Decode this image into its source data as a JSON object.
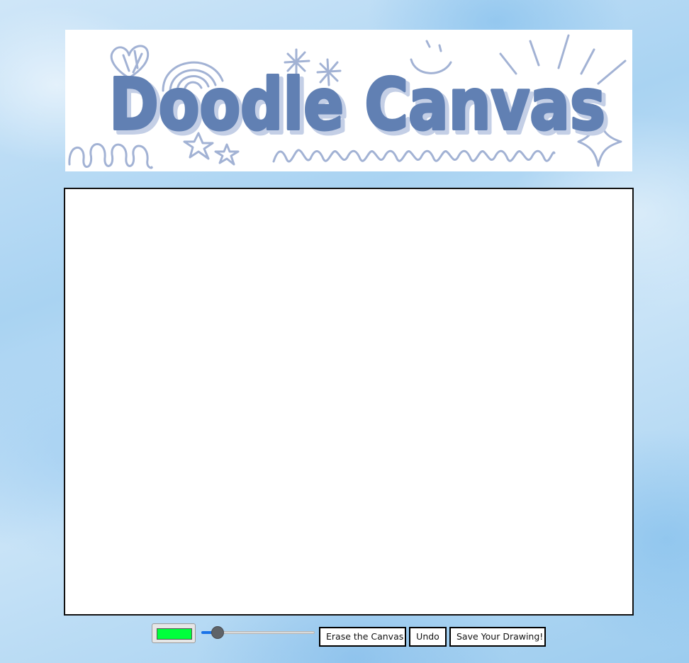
{
  "header": {
    "title": "Doodle Canvas",
    "title_color": "#6180b3"
  },
  "drawing_canvas": {
    "background": "#ffffff"
  },
  "toolbar": {
    "color_picker_value": "#00ff3c",
    "brush_size_level": 0.1,
    "erase_label": "Erase the Canvas",
    "undo_label": "Undo",
    "save_label": "Save Your Drawing!"
  },
  "colors": {
    "slider_accent": "#1a73e8",
    "doodle_stroke": "#a2b2d4"
  },
  "decorations": [
    "heart-doodle",
    "rainbow-doodle",
    "sparkle-doodle",
    "smile-doodle",
    "sun-rays-doodle",
    "loops-doodle",
    "star-doodle",
    "wave-doodle",
    "diamond-sparkle-doodle"
  ]
}
